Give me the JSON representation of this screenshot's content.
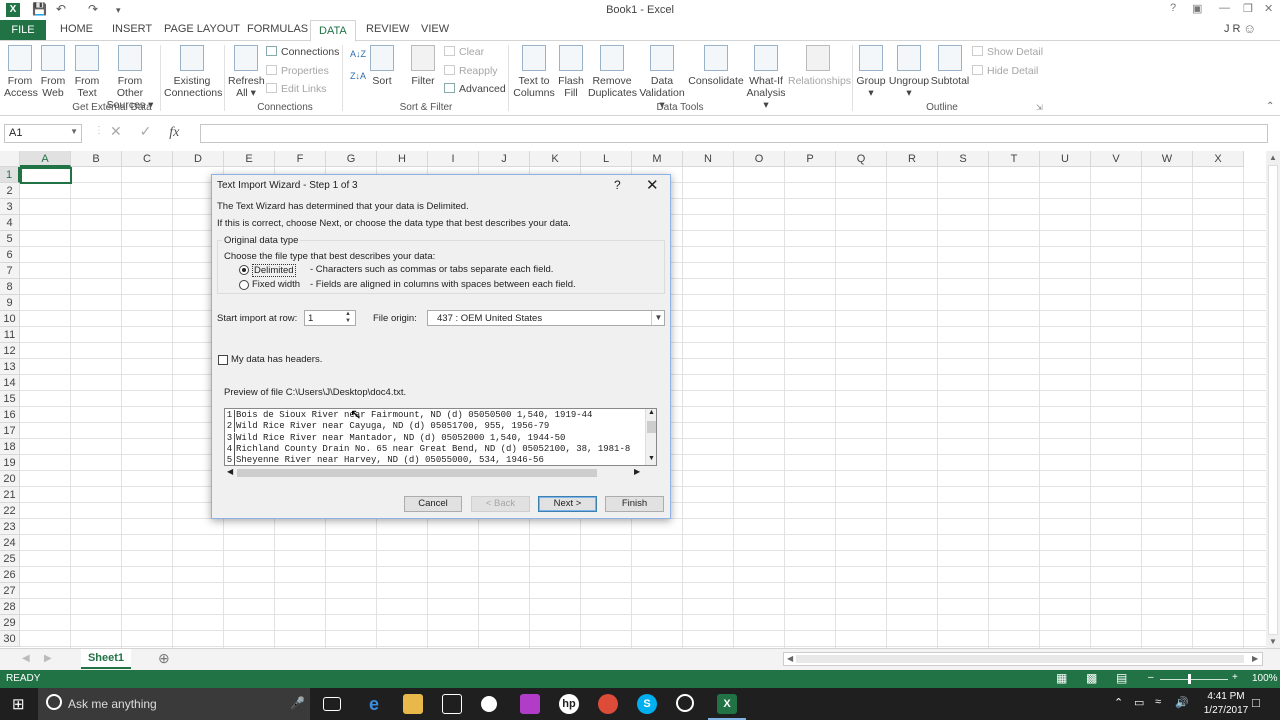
{
  "window": {
    "title": "Book1 - Excel",
    "user": "J R",
    "help": "?"
  },
  "tabs": [
    "FILE",
    "HOME",
    "INSERT",
    "PAGE LAYOUT",
    "FORMULAS",
    "DATA",
    "REVIEW",
    "VIEW"
  ],
  "active_tab": "DATA",
  "ribbon": {
    "from_access": [
      "From",
      "Access"
    ],
    "from_web": [
      "From",
      "Web"
    ],
    "from_text": [
      "From",
      "Text"
    ],
    "from_other": [
      "From Other",
      "Sources ▾"
    ],
    "existing": [
      "Existing",
      "Connections"
    ],
    "refresh": [
      "Refresh",
      "All ▾"
    ],
    "connections": "Connections",
    "properties": "Properties",
    "edit_links": "Edit Links",
    "sort_az": "A↓Z",
    "sort": "Sort",
    "filter": "Filter",
    "clear": "Clear",
    "reapply": "Reapply",
    "advanced": "Advanced",
    "text_to_columns": [
      "Text to",
      "Columns"
    ],
    "flash_fill": [
      "Flash",
      "Fill"
    ],
    "remove_duplicates": [
      "Remove",
      "Duplicates"
    ],
    "data_validation": [
      "Data",
      "Validation ▾"
    ],
    "consolidate": "Consolidate",
    "what_if": [
      "What-If",
      "Analysis ▾"
    ],
    "relationships": "Relationships",
    "group": [
      "Group",
      "▾"
    ],
    "ungroup": [
      "Ungroup",
      "▾"
    ],
    "subtotal": "Subtotal",
    "show_detail": "Show Detail",
    "hide_detail": "Hide Detail",
    "groups": {
      "external": "Get External Data",
      "connections": "Connections",
      "sortfilter": "Sort & Filter",
      "datatools": "Data Tools",
      "outline": "Outline"
    }
  },
  "formula_bar": {
    "name_box": "A1",
    "fx": "fx",
    "cancel": "✕",
    "enter": "✓"
  },
  "grid": {
    "columns": [
      "A",
      "B",
      "C",
      "D",
      "E",
      "F",
      "G",
      "H",
      "I",
      "J",
      "K",
      "L",
      "M",
      "N",
      "O",
      "P",
      "Q",
      "R",
      "S",
      "T",
      "U",
      "V",
      "W",
      "X"
    ],
    "rows": [
      "1",
      "2",
      "3",
      "4",
      "5",
      "6",
      "7",
      "8",
      "9",
      "10",
      "11",
      "12",
      "13",
      "14",
      "15",
      "16",
      "17",
      "18",
      "19",
      "20",
      "21",
      "22",
      "23",
      "24",
      "25",
      "26",
      "27",
      "28",
      "29",
      "30"
    ]
  },
  "sheet": {
    "tab": "Sheet1",
    "add": "⊕"
  },
  "status": {
    "text": "READY",
    "zoom": "100%"
  },
  "taskbar": {
    "search": "Ask me anything",
    "time": "4:41 PM",
    "date": "1/27/2017"
  },
  "dialog": {
    "title": "Text Import Wizard - Step 1 of 3",
    "help": "?",
    "close": "✕",
    "line1": "The Text Wizard has determined that your data is Delimited.",
    "line2": "If this is correct, choose Next, or choose the data type that best describes your data.",
    "group_label": "Original data type",
    "choose": "Choose the file type that best describes your data:",
    "opt_delimited": "Delimited",
    "opt_delimited_desc": "- Characters such as commas or tabs separate each field.",
    "opt_fixed": "Fixed width",
    "opt_fixed_desc": "- Fields are aligned in columns with spaces between each field.",
    "start_label": "Start import at row:",
    "start_value": "1",
    "origin_label": "File origin:",
    "origin_value": "437 : OEM United States",
    "headers_label": "My data has headers.",
    "preview_label": "Preview of file C:\\Users\\J\\Desktop\\doc4.txt.",
    "preview_lines": [
      {
        "n": "1",
        "t": "Bois de Sioux River near Fairmount, ND (d) 05050500 1,540, 1919-44"
      },
      {
        "n": "2",
        "t": "Wild Rice River near Cayuga, ND (d) 05051700, 955, 1956-79"
      },
      {
        "n": "3",
        "t": "Wild Rice River near Mantador, ND (d) 05052000 1,540, 1944-50"
      },
      {
        "n": "4",
        "t": "Richland County Drain No. 65 near Great Bend, ND (d) 05052100, 38, 1981-8"
      },
      {
        "n": "5",
        "t": "Sheyenne River near Harvey, ND (d) 05055000, 534, 1946-56"
      }
    ],
    "btn_cancel": "Cancel",
    "btn_back": "< Back",
    "btn_next": "Next >",
    "btn_finish": "Finish"
  },
  "colors": {
    "excel_green": "#217346",
    "dialog_border": "#8db2e3"
  }
}
